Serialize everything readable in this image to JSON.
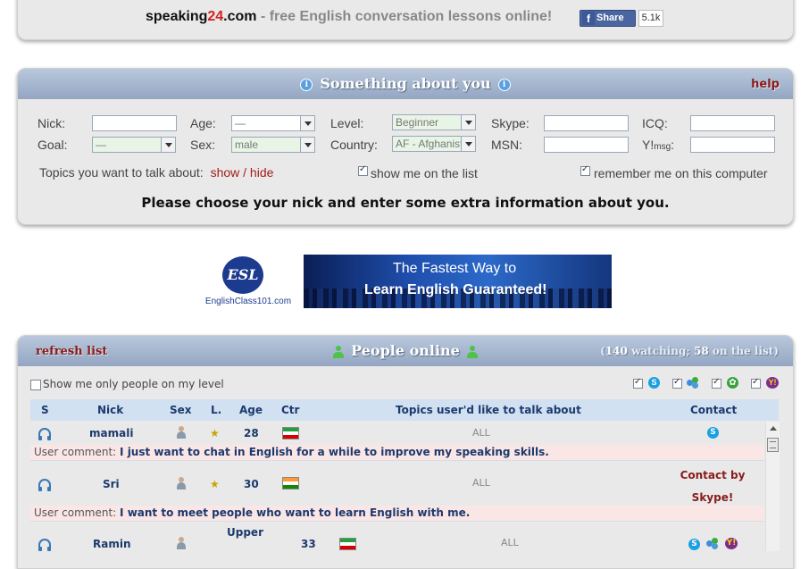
{
  "header": {
    "brand_a": "speaking",
    "brand_b": "24",
    "brand_c": ".com",
    "tagline": " - free English conversation lessons online!",
    "share_label": "Share",
    "share_count": "5.1k"
  },
  "about": {
    "title": "Something about you",
    "help": "help",
    "labels": {
      "nick": "Nick:",
      "age": "Age:",
      "level": "Level:",
      "skype": "Skype:",
      "icq": "ICQ:",
      "goal": "Goal:",
      "sex": "Sex:",
      "country": "Country:",
      "msn": "MSN:",
      "ymsg_main": "Y!",
      "ymsg_sub": "msg",
      "ymsg_colon": ":"
    },
    "values": {
      "age": "—",
      "level": "Beginner",
      "goal": "—",
      "sex": "male",
      "country": "AF - Afghanistan"
    },
    "topics_label": "Topics you want to talk about:",
    "show": "show",
    "slash": " / ",
    "hide": "hide",
    "show_on_list": "show me on the list",
    "remember": "remember me on this computer",
    "prompt": "Please choose your nick and enter some extra information about you."
  },
  "ad": {
    "logo_text": "ESL",
    "logo_caption": "EnglishClass101.com",
    "banner_line1": "The Fastest Way to",
    "banner_line2": "Learn English Guaranteed!"
  },
  "people": {
    "refresh": "refresh list",
    "title": "People online",
    "paren_open": "(",
    "watching_count": "140",
    "watching_label": " watching; ",
    "list_count": "58",
    "list_label": " on the list)",
    "level_filter": "Show me only people on my level",
    "columns": [
      "S",
      "Nick",
      "Sex",
      "L.",
      "Age",
      "Ctr",
      "Topics user'd like to talk about",
      "Contact"
    ],
    "rows": [
      {
        "nick": "mamali",
        "age": "28",
        "topics": "ALL",
        "comment_label": "User comment: ",
        "comment": "I just want to chat in English for a while to improve my speaking skills."
      },
      {
        "nick": "Sri",
        "age": "30",
        "topics": "ALL",
        "contact_text": "Contact by Skype!",
        "comment_label": "User comment: ",
        "comment": "I want to meet people who want to learn English with me."
      },
      {
        "nick": "Ramin",
        "level": "Upper",
        "age": "33",
        "topics": "ALL"
      }
    ],
    "colors": {
      "iran_green": "#239f40",
      "iran_red": "#da0000",
      "india_saffron": "#ff9933",
      "india_green": "#138808"
    }
  }
}
